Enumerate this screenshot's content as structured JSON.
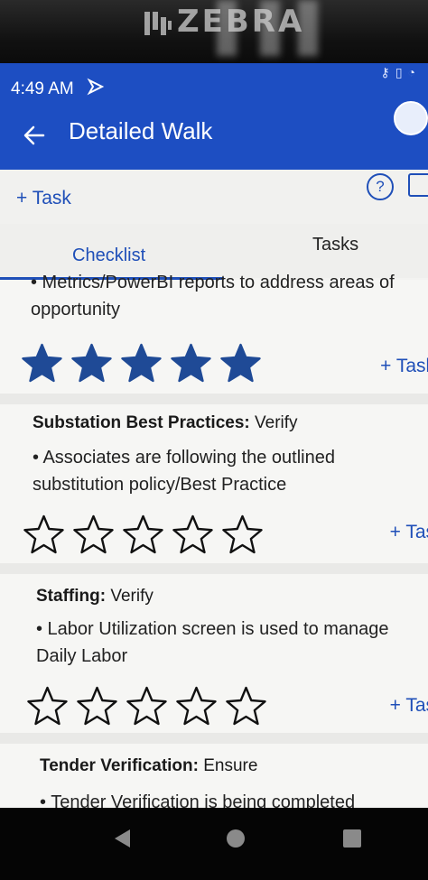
{
  "device": {
    "brand": "ZEBRA"
  },
  "status_bar": {
    "time": "4:49 AM"
  },
  "app_bar": {
    "title": "Detailed Walk"
  },
  "toolbar": {
    "add_task_label": "+ Task",
    "help_symbol": "?"
  },
  "tabs": [
    {
      "label": "Checklist",
      "active": true
    },
    {
      "label": "Tasks",
      "active": false
    }
  ],
  "items": [
    {
      "title": "",
      "qualifier": "",
      "bullet": "• Metrics/PowerBI reports to address areas of opportunity",
      "rating": 5,
      "task_link": "+ Task"
    },
    {
      "title": "Substation Best Practices:",
      "qualifier": "Verify",
      "bullet": "• Associates are following the outlined substitution policy/Best Practice",
      "rating": 0,
      "task_link": "+ Tas"
    },
    {
      "title": "Staffing:",
      "qualifier": "Verify",
      "bullet": "• Labor Utilization screen is used to manage Daily Labor",
      "rating": 0,
      "task_link": "+ Tas"
    },
    {
      "title": "Tender Verification:",
      "qualifier": "Ensure",
      "bullet": "• Tender Verification is being completed",
      "rating": 0,
      "task_link": ""
    }
  ],
  "colors": {
    "accent": "#1f4fb8",
    "app_bar": "#1d4ec2",
    "star_filled": "#1f4a96"
  }
}
